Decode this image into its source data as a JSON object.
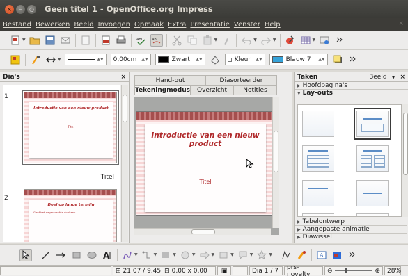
{
  "window": {
    "title": "Geen titel 1 - OpenOffice.org Impress"
  },
  "menu": [
    "Bestand",
    "Bewerken",
    "Beeld",
    "Invoegen",
    "Opmaak",
    "Extra",
    "Presentatie",
    "Venster",
    "Help"
  ],
  "line_toolbar": {
    "width_value": "0,00cm",
    "line_color": "Zwart",
    "area_style": "Kleur",
    "area_color": "Blauw 7",
    "area_color_hex": "#36a3d9"
  },
  "slides_panel": {
    "title": "Dia's",
    "slides": [
      {
        "number": "1",
        "title": "Introductie van een nieuw product",
        "body": "Titel",
        "caption": "Titel"
      },
      {
        "number": "2",
        "title": "Doel op lange termijn",
        "bullet": "Geef het nagestreefde doel aan"
      }
    ]
  },
  "view_tabs": {
    "row1": [
      "Hand-out",
      "Diasorteerder"
    ],
    "row2": [
      "Tekeningmodus",
      "Overzicht",
      "Notities"
    ],
    "active": "Tekeningmodus"
  },
  "slide_editor": {
    "title": "Introductie van een nieuw product",
    "subtitle": "Titel"
  },
  "tasks_panel": {
    "title": "Taken",
    "view_label": "Beeld",
    "sections_top": [
      "Hoofdpagina's",
      "Lay-outs"
    ],
    "sections_bottom": [
      "Tabelontwerp",
      "Aangepaste animatie",
      "Diawissel"
    ]
  },
  "statusbar": {
    "position": "21,07 / 9,45",
    "size": "0,00 x 0,00",
    "slide_info": "Dia 1 / 7",
    "layout_name": "prs-novelty",
    "zoom": "28%"
  },
  "colors": {
    "titlebar": "#3b3b37",
    "slide_title_red": "#b0292b",
    "stripe_pink": "#f7d6d6",
    "layout_blue": "#5c8dc6"
  }
}
